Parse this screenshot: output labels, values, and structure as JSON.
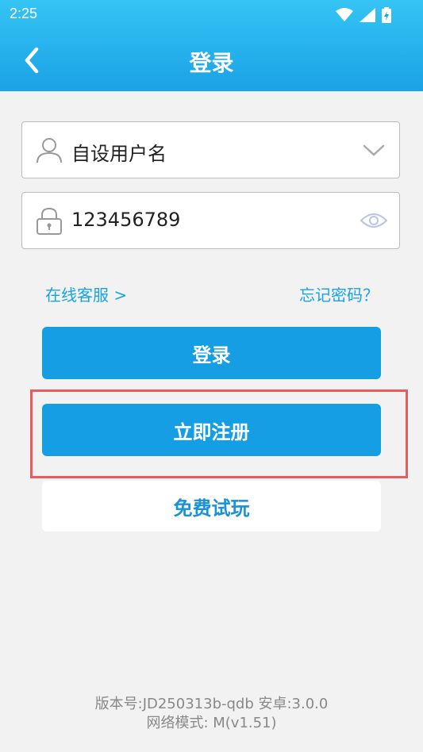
{
  "status_bar": {
    "time": "2:25"
  },
  "header": {
    "title": "登录"
  },
  "form": {
    "username_value": "自设用户名",
    "password_value": "123456789"
  },
  "links": {
    "customer_service": "在线客服 >",
    "forgot_password": "忘记密码？"
  },
  "buttons": {
    "login": "登录",
    "register": "立即注册",
    "trial": "免费试玩"
  },
  "footer": {
    "version": "版本号:JD250313b-qdb  安卓:3.0.0",
    "network_mode": "网络模式: M(v1.51)"
  },
  "colors": {
    "brand_blue": "#169ee4",
    "highlight_red": "#e85c5f"
  },
  "icons": [
    "wifi-icon",
    "signal-icon",
    "battery-icon",
    "back-arrow-icon",
    "user-icon",
    "chevron-down-icon",
    "lock-icon",
    "eye-icon"
  ]
}
